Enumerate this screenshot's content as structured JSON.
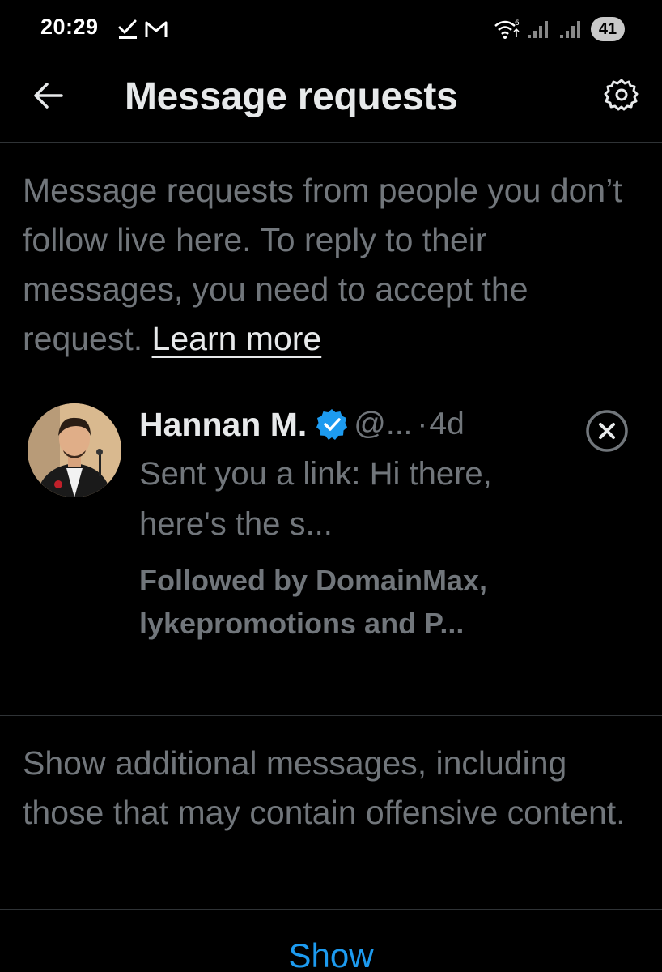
{
  "status_bar": {
    "time": "20:29",
    "battery": "41",
    "icons": [
      "check-icon",
      "gmail-icon",
      "wifi-icon",
      "signal-icon",
      "signal-icon"
    ]
  },
  "header": {
    "title": "Message requests",
    "back_icon": "arrow-left-icon",
    "settings_icon": "gear-icon"
  },
  "info": {
    "text": "Message requests from people you don’t follow live here. To reply to their messages, you need to accept the request. ",
    "link": "Learn more"
  },
  "requests": [
    {
      "name": "Hannan M.",
      "handle": "@...",
      "separator": "·",
      "time": "4d",
      "preview": "Sent you a link: Hi there, here's the s...",
      "followed_by": "Followed by DomainMax, lykepromotions and P...",
      "verified": true
    }
  ],
  "additional": {
    "text": "Show additional messages, including those that may contain offensive content.",
    "button": "Show"
  },
  "colors": {
    "background": "#000000",
    "primary_text": "#e7e9ea",
    "secondary_text": "#71767b",
    "accent": "#1d9bf0",
    "divider": "#2f3336"
  }
}
